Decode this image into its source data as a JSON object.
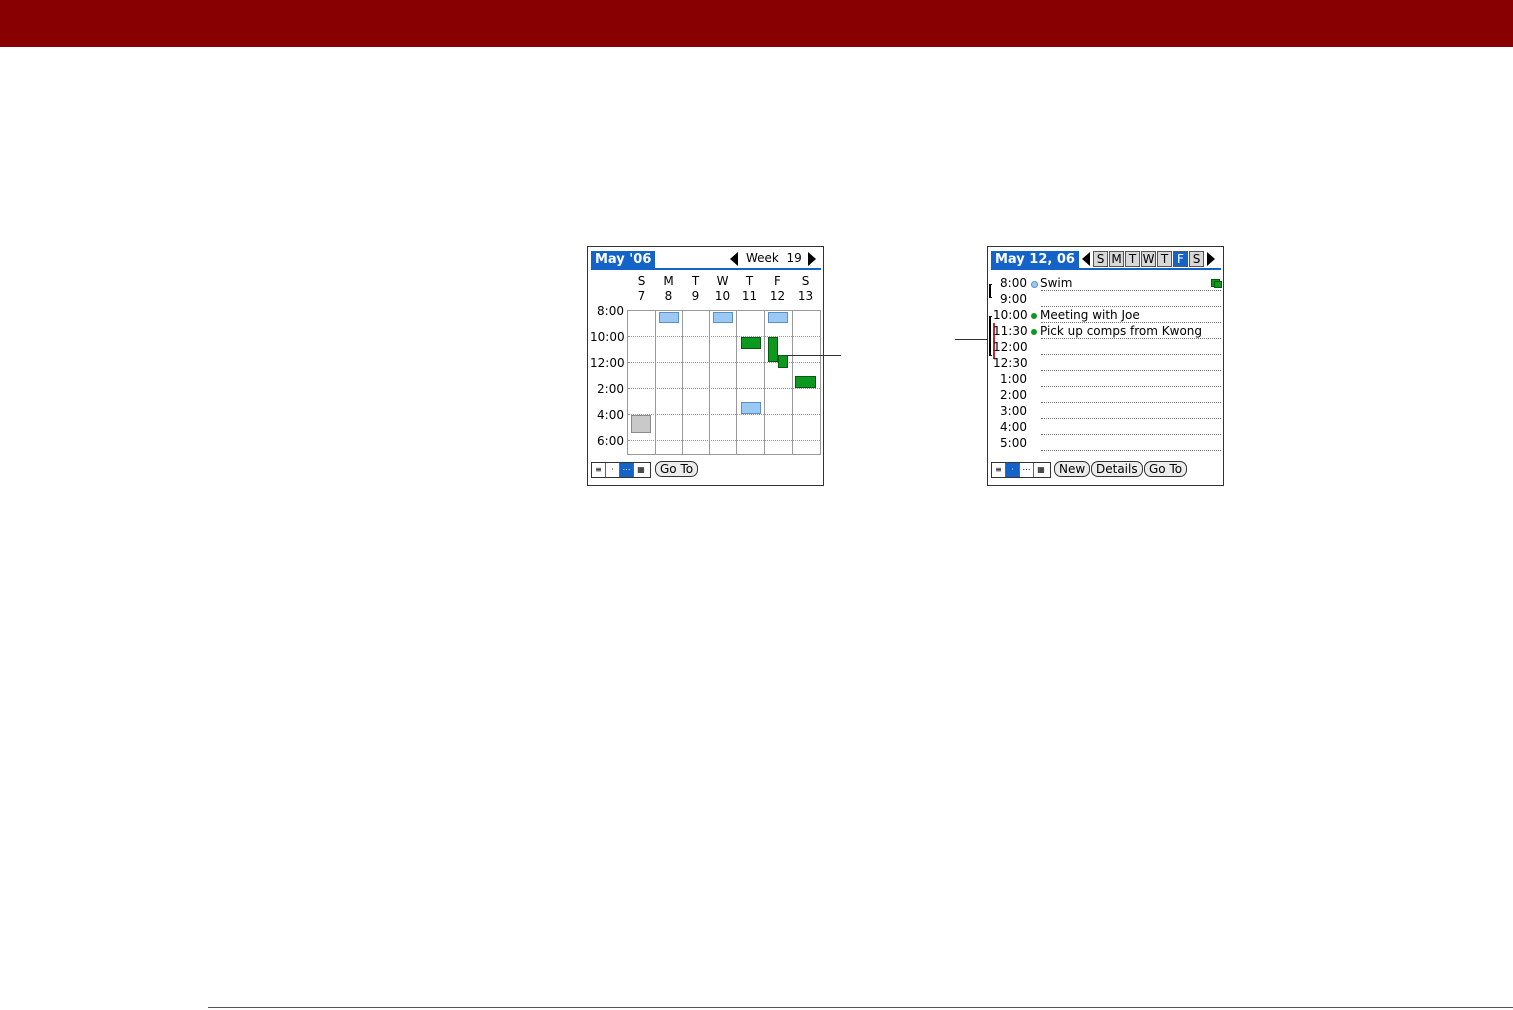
{
  "colors": {
    "brand_bar": "#880002",
    "tab_blue": "#1463c8",
    "event_green": "#0c9a1e",
    "event_blue": "#9cc8f4",
    "event_gray": "#c9c9c9"
  },
  "week_view": {
    "title": "May '06",
    "week_label": "Week  19",
    "days": [
      {
        "letter": "S",
        "num": "7"
      },
      {
        "letter": "M",
        "num": "8"
      },
      {
        "letter": "T",
        "num": "9"
      },
      {
        "letter": "W",
        "num": "10"
      },
      {
        "letter": "T",
        "num": "11"
      },
      {
        "letter": "F",
        "num": "12"
      },
      {
        "letter": "S",
        "num": "13"
      }
    ],
    "hours": [
      "8:00",
      "10:00",
      "12:00",
      "2:00",
      "4:00",
      "6:00"
    ],
    "view_buttons": [
      "agenda-view-icon",
      "day-view-icon",
      "week-view-icon",
      "month-view-icon"
    ],
    "active_view": 2,
    "go_to": "Go To"
  },
  "day_view": {
    "title": "May 12, 06",
    "week_days": [
      "S",
      "M",
      "T",
      "W",
      "T",
      "F",
      "S"
    ],
    "selected_day": 5,
    "times": [
      "8:00",
      "9:00",
      "10:00",
      "11:30",
      "12:00",
      "12:30",
      "1:00",
      "2:00",
      "3:00",
      "4:00",
      "5:00"
    ],
    "events": [
      {
        "time": "8:00",
        "text": "Swim",
        "color": "#9cc8f4"
      },
      {
        "time": "10:00",
        "text": "Meeting with Joe",
        "color": "#0c9a1e"
      },
      {
        "time": "11:30",
        "text": "Pick up comps from Kwong",
        "color": "#0c9a1e"
      }
    ],
    "view_buttons": [
      "agenda-view-icon",
      "day-view-icon",
      "week-view-icon",
      "month-view-icon"
    ],
    "active_view": 1,
    "buttons": {
      "new": "New",
      "details": "Details",
      "go_to": "Go To"
    }
  }
}
